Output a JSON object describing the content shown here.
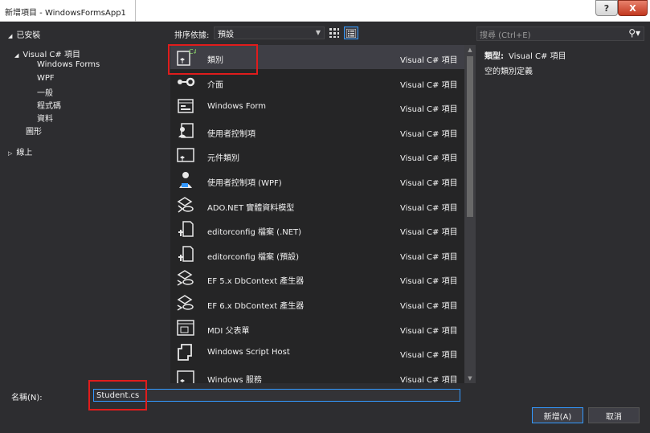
{
  "window": {
    "title": "新增項目 - WindowsFormsApp1",
    "help_label": "?",
    "close_label": "X"
  },
  "tree": {
    "installed": "已安裝",
    "visual_csharp": "Visual C# 項目",
    "windows_forms": "Windows Forms",
    "wpf": "WPF",
    "general": "一般",
    "code": "程式碼",
    "data": "資料",
    "graphics": "圖形",
    "online": "線上"
  },
  "toolbar": {
    "sort_label": "排序依據:",
    "sort_value": "預設",
    "search_placeholder": "搜尋 (Ctrl+E)"
  },
  "templates": [
    {
      "name": "類別",
      "lang": "Visual C# 項目",
      "icon": "class-icon",
      "selected": true
    },
    {
      "name": "介面",
      "lang": "Visual C# 項目",
      "icon": "interface-icon"
    },
    {
      "name": "Windows Form",
      "lang": "Visual C# 項目",
      "icon": "windows-form-icon"
    },
    {
      "name": "使用者控制項",
      "lang": "Visual C# 項目",
      "icon": "user-control-icon"
    },
    {
      "name": "元件類別",
      "lang": "Visual C# 項目",
      "icon": "component-class-icon"
    },
    {
      "name": "使用者控制項 (WPF)",
      "lang": "Visual C# 項目",
      "icon": "user-control-wpf-icon"
    },
    {
      "name": "ADO.NET 實體資料模型",
      "lang": "Visual C# 項目",
      "icon": "ado-entity-model-icon"
    },
    {
      "name": "editorconfig 檔案 (.NET)",
      "lang": "Visual C# 項目",
      "icon": "editorconfig-icon"
    },
    {
      "name": "editorconfig 檔案 (預設)",
      "lang": "Visual C# 項目",
      "icon": "editorconfig-icon"
    },
    {
      "name": "EF 5.x DbContext 產生器",
      "lang": "Visual C# 項目",
      "icon": "ef-generator-icon"
    },
    {
      "name": "EF 6.x DbContext 產生器",
      "lang": "Visual C# 項目",
      "icon": "ef-generator-icon"
    },
    {
      "name": "MDI 父表單",
      "lang": "Visual C# 項目",
      "icon": "mdi-form-icon"
    },
    {
      "name": "Windows Script Host",
      "lang": "Visual C# 項目",
      "icon": "script-host-icon"
    },
    {
      "name": "Windows 服務",
      "lang": "Visual C# 項目",
      "icon": "windows-service-icon"
    }
  ],
  "info": {
    "type_label": "類型:",
    "type_value": "Visual C# 項目",
    "description": "空的類別定義"
  },
  "bottom": {
    "name_label": "名稱(N):",
    "name_value": "Student.cs",
    "add_label": "新增(A)",
    "cancel_label": "取消"
  },
  "colors": {
    "background": "#2d2d30",
    "list_background": "#252526",
    "accent": "#3399ff",
    "highlight": "#e01c1c"
  }
}
